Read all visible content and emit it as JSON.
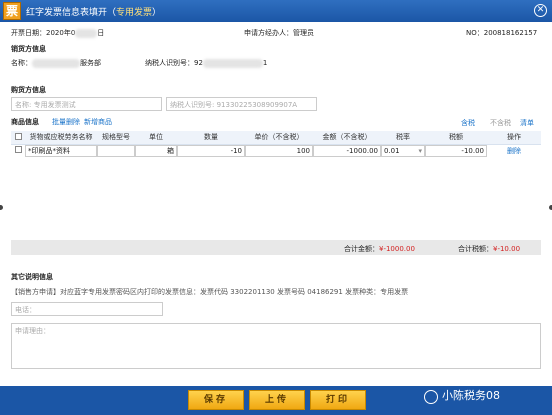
{
  "window": {
    "logo": "票",
    "title_prefix": "红字发票信息表填开（",
    "title_highlight": "专用发票",
    "title_suffix": "）",
    "close": "✕"
  },
  "header": {
    "issue_date_label": "开票日期：",
    "issue_date_value": "2020年0",
    "issue_date_tail": "日",
    "handler": "申请方经办人：管理员",
    "no": "NO：200818162157"
  },
  "seller": {
    "section_title": "销货方信息",
    "name_label": "名称：",
    "name_prefix": "",
    "name_suffix": "服务部",
    "taxid_label": "纳税人识别号：",
    "taxid_prefix": "92",
    "taxid_suffix": "1"
  },
  "buyer": {
    "section_title": "购货方信息",
    "name_placeholder": "名称: 专用发票测试",
    "taxid_value": "纳税人识别号: 91330225308909907A"
  },
  "goods": {
    "section_title": "商品信息",
    "batch_delete": "批量删除",
    "add_goods": "新增商品",
    "tax_included": "含税",
    "tax_excluded": "不含税",
    "clear": "清单",
    "columns": [
      "货物或应税劳务名称",
      "规格型号",
      "单位",
      "数量",
      "单价（不含税）",
      "金额（不含税）",
      "税率",
      "税额",
      "操作"
    ],
    "row": {
      "name": "*印刷品*资料",
      "spec": "",
      "unit": "箱",
      "qty": "-10",
      "price": "100",
      "amount": "-1000.00",
      "rate": "0.01",
      "tax": "-10.00",
      "action": "删除"
    }
  },
  "summary": {
    "total_amount_label": "合计金额：",
    "total_amount_value": "¥-1000.00",
    "total_tax_label": "合计税额：",
    "total_tax_value": "¥-10.00"
  },
  "other": {
    "section_title": "其它说明信息",
    "note": "【销售方申请】对应蓝字专用发票密码区内打印的发票信息：发票代码 3302201130 发票号码 04186291 发票种类：专用发票",
    "phone_placeholder": "电话：",
    "reason_placeholder": "申请理由："
  },
  "footer": {
    "save": "保存",
    "upload": "上传",
    "print": "打印",
    "watermark": "小陈税务08"
  }
}
